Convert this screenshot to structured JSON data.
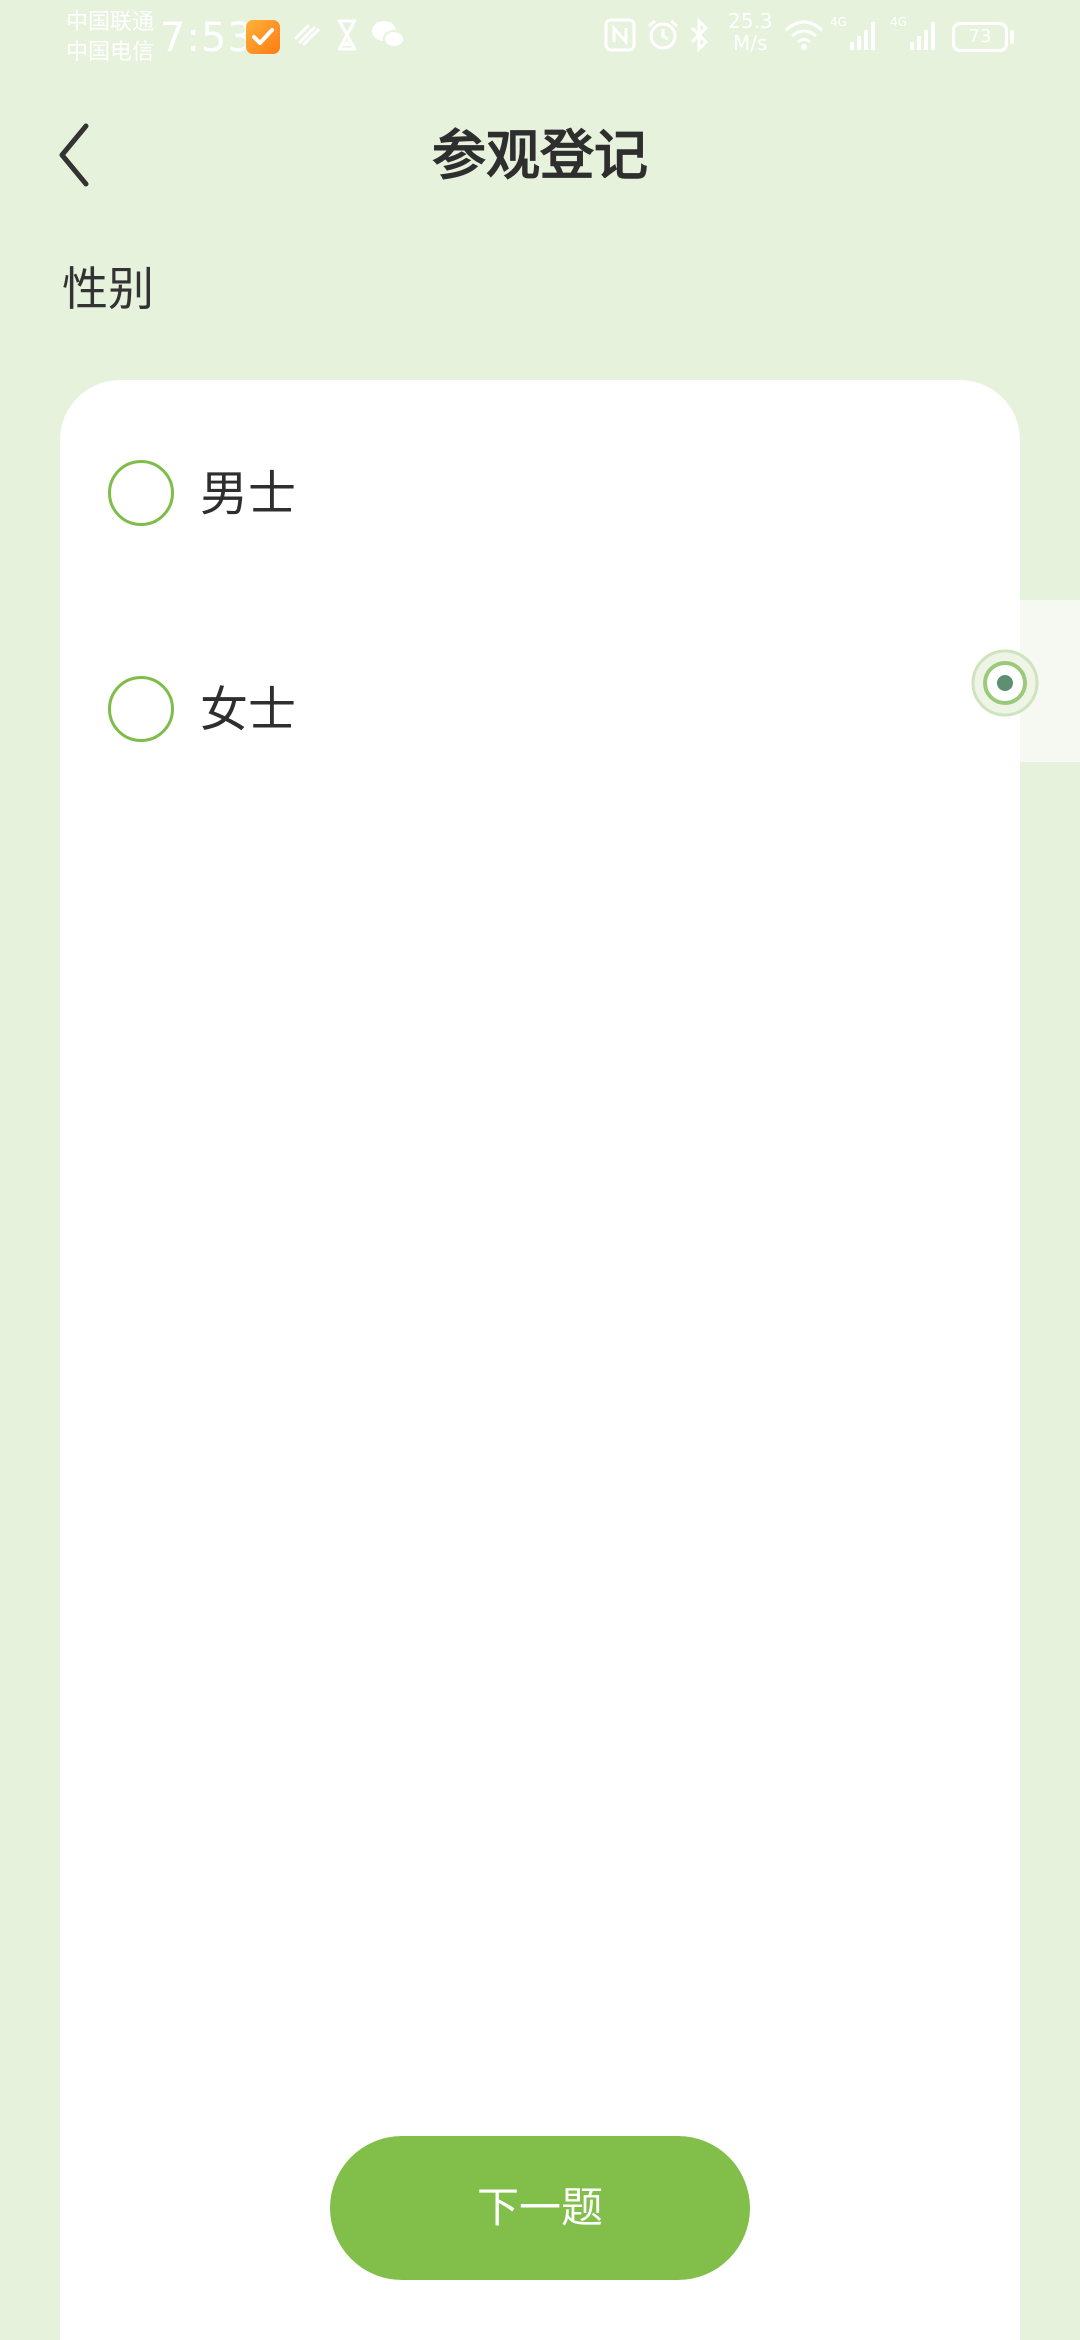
{
  "status_bar": {
    "carrier_1": "中国联通",
    "carrier_2": "中国电信",
    "time": "7:53",
    "network_speed": "25.3",
    "network_speed_unit": "M/s",
    "battery": "73",
    "signal_1_label": "4G",
    "signal_2_label": "4G"
  },
  "header": {
    "title": "参观登记"
  },
  "question": {
    "label": "性别",
    "options": [
      {
        "label": "男士",
        "selected": false
      },
      {
        "label": "女士",
        "selected": false
      }
    ]
  },
  "footer": {
    "next_button_label": "下一题"
  },
  "colors": {
    "background": "#e6f2dc",
    "accent": "#82be4a",
    "radio_border": "#7fbc4a"
  },
  "icons": {
    "back": "chevron-left-icon",
    "float": "target-icon"
  }
}
